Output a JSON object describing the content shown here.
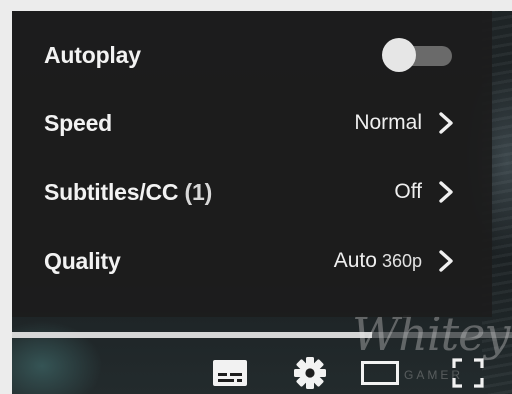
{
  "settings": {
    "autoplay": {
      "label": "Autoplay",
      "enabled": false
    },
    "speed": {
      "label": "Speed",
      "value": "Normal"
    },
    "subtitles": {
      "label": "Subtitles/CC",
      "count": "(1)",
      "value": "Off"
    },
    "quality": {
      "label": "Quality",
      "value": "Auto",
      "resolution": "360p"
    }
  },
  "progress": {
    "played_fraction": 0.72
  },
  "watermark": {
    "text": "Whitey",
    "subtext": "GAMER"
  },
  "controls": [
    "subtitles-icon",
    "gear-icon",
    "theater-mode-icon",
    "fullscreen-icon"
  ],
  "colors": {
    "menu_bg": "#1c1c1c",
    "text": "#eeeeee",
    "toggle_track": "#6a6a6a",
    "toggle_knob": "#e6e6e6"
  }
}
